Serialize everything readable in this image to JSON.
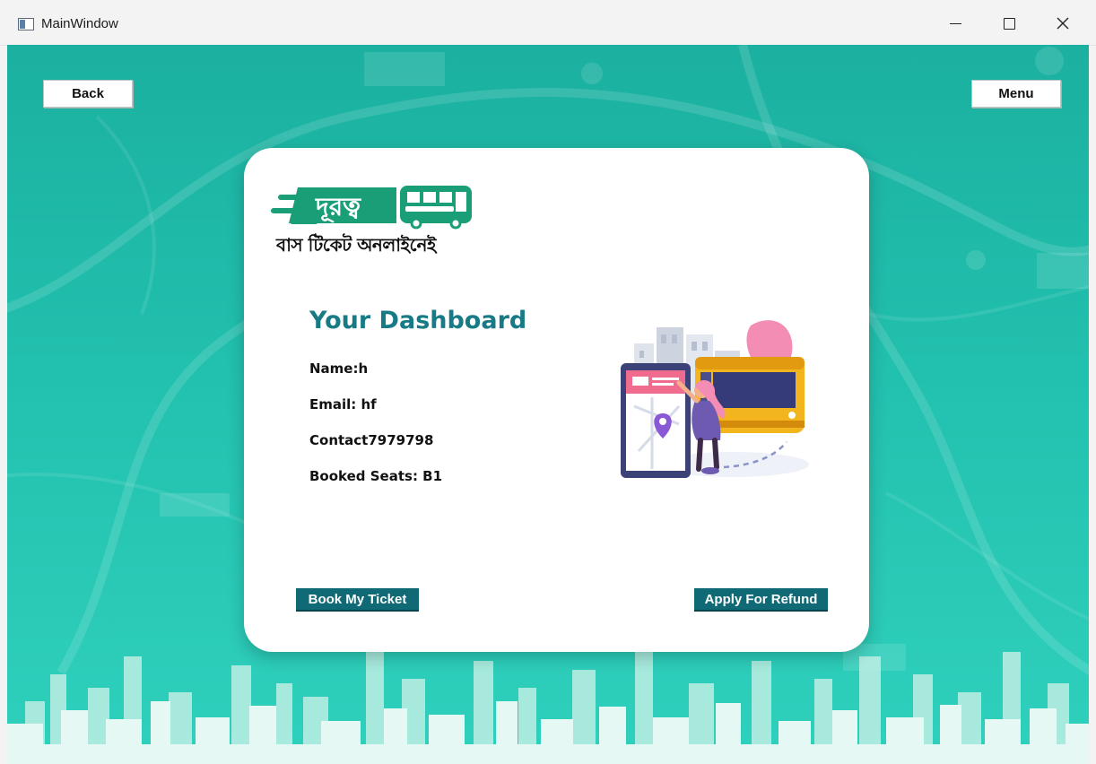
{
  "window": {
    "title": "MainWindow"
  },
  "nav": {
    "back_label": "Back",
    "menu_label": "Menu"
  },
  "logo": {
    "brand": "দূরত্ব",
    "tagline": "বাস টিকেট অনলাইনেই"
  },
  "dashboard": {
    "title": "Your Dashboard",
    "name": "Name:h",
    "email": "Email: hf",
    "contact": "Contact7979798",
    "booked_seats": "Booked Seats: B1"
  },
  "actions": {
    "book_label": "Book My Ticket",
    "refund_label": "Apply For Refund"
  },
  "icons": {
    "app": "app-window-icon",
    "minimize": "minimize-icon",
    "maximize": "maximize-icon",
    "close": "close-icon",
    "bus": "bus-icon"
  },
  "colors": {
    "background": "#22c0ae",
    "accent": "#177a85",
    "button": "#0f6a76",
    "logo_green": "#1a9e78"
  }
}
